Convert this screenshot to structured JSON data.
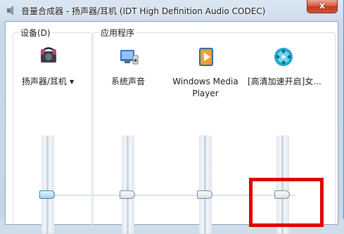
{
  "window": {
    "title": "音量合成器 - 扬声器/耳机 (IDT High Definition Audio CODEC)",
    "close_label": "x"
  },
  "groups": {
    "device_label": "设备(D)",
    "apps_label": "应用程序"
  },
  "columns": [
    {
      "label": "扬声器/耳机",
      "icon": "speaker-headphones-icon",
      "has_dropdown": true,
      "volume_fraction": 0.0
    },
    {
      "label": "系统声音",
      "icon": "system-sounds-icon",
      "volume_fraction": 0.0
    },
    {
      "label": "Windows Media Player",
      "icon": "windows-media-player-icon",
      "volume_fraction": 0.0
    },
    {
      "label": "[高清加速开启]女...",
      "icon": "video-player-icon",
      "volume_fraction": 0.0
    }
  ],
  "dropdown_arrow": "▼",
  "colors": {
    "highlight_box": "#e00000",
    "close_button": "#c1391c"
  }
}
